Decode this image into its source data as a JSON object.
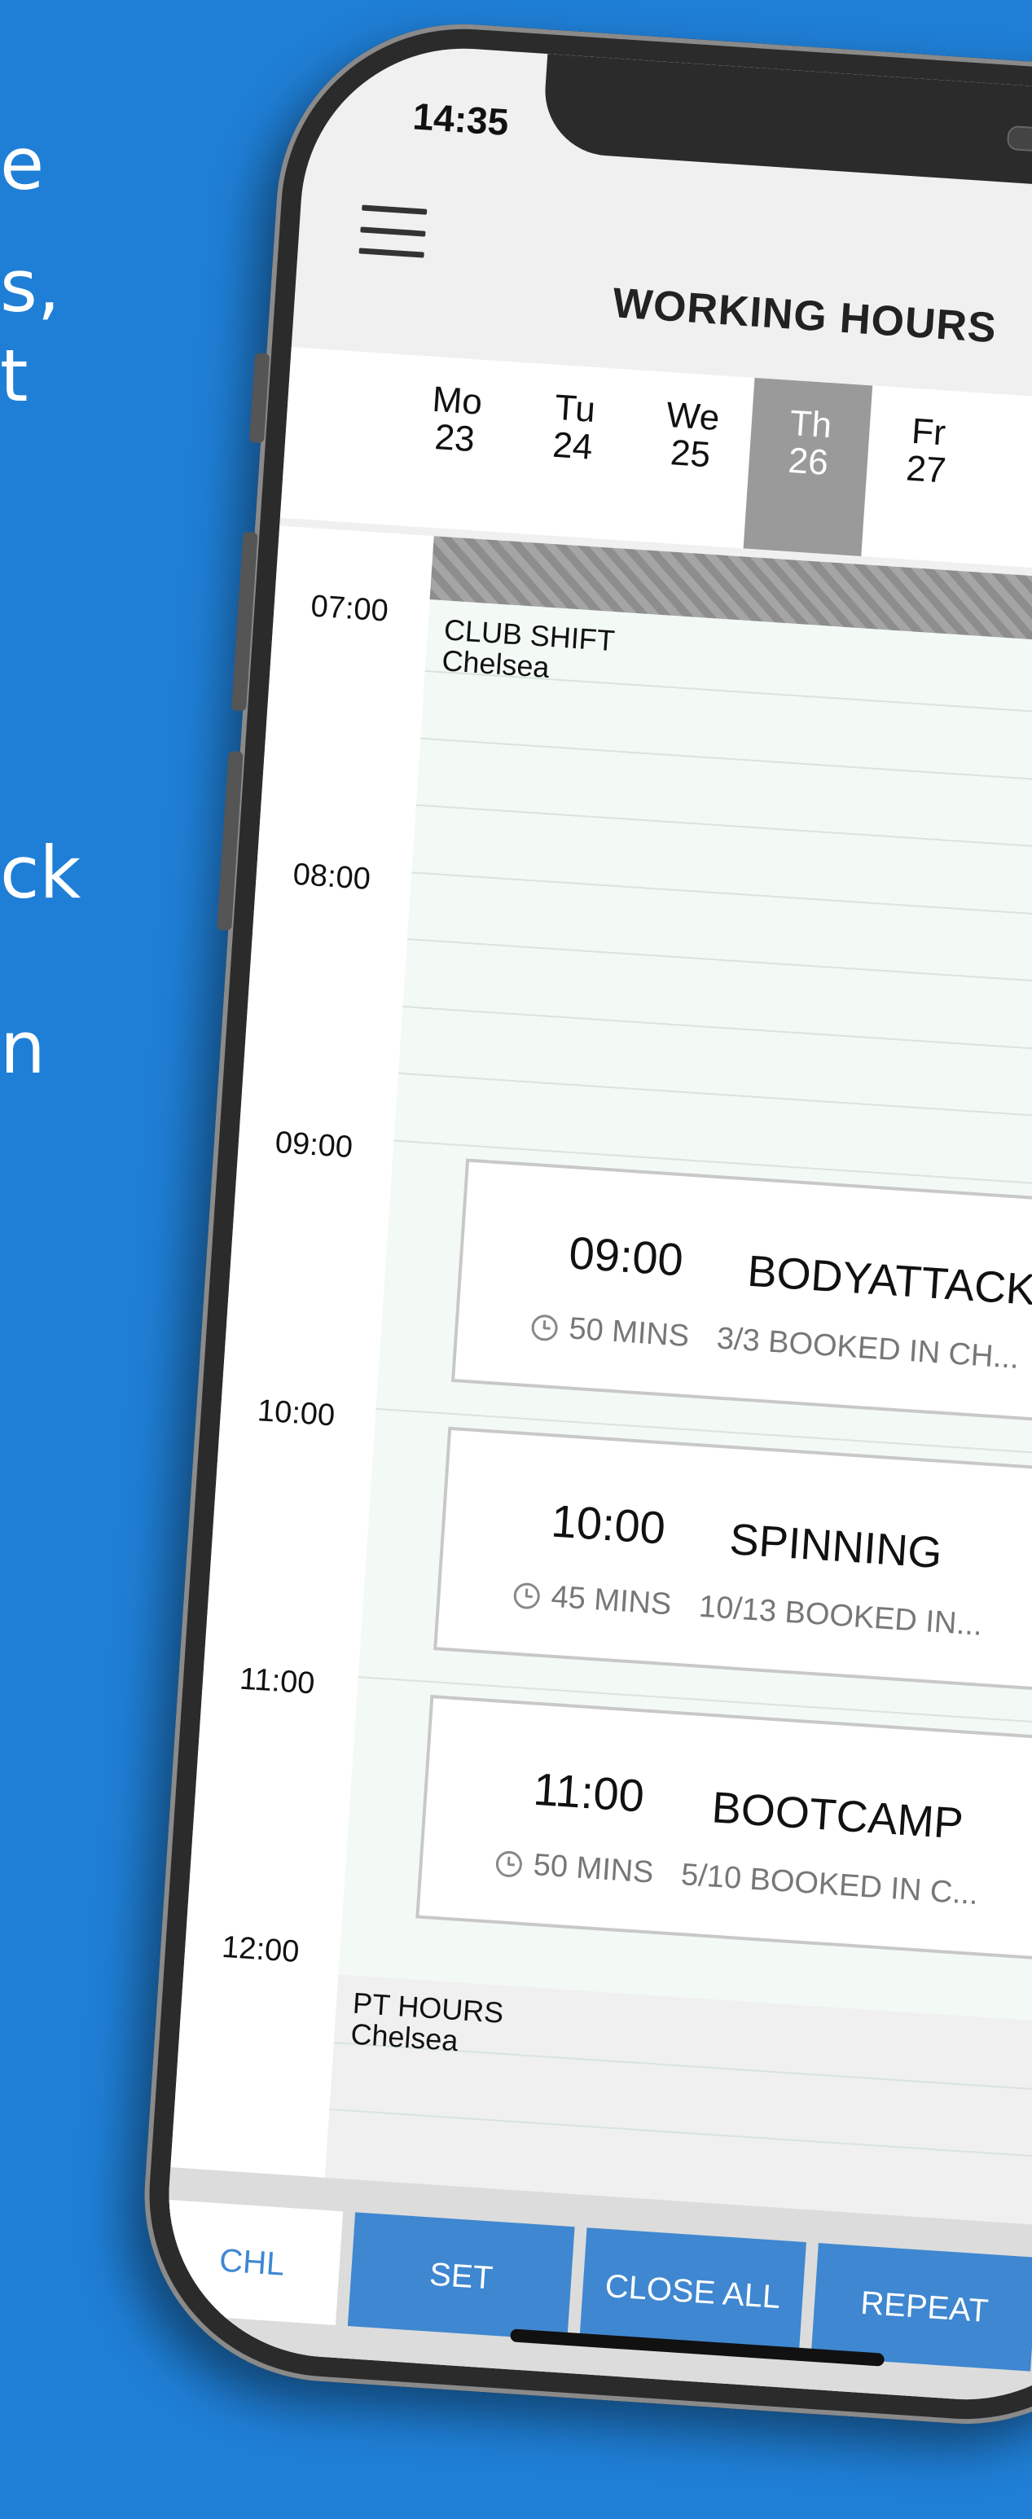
{
  "background_text": {
    "line1": "e",
    "line2": "s,",
    "line3": "t",
    "line4": "ck",
    "line5": "n"
  },
  "status_bar": {
    "time": "14:35"
  },
  "header": {
    "title": "WORKING HOURS"
  },
  "days": [
    {
      "name": "Mo",
      "date": "23"
    },
    {
      "name": "Tu",
      "date": "24"
    },
    {
      "name": "We",
      "date": "25"
    },
    {
      "name": "Th",
      "date": "26"
    },
    {
      "name": "Fr",
      "date": "27"
    }
  ],
  "selected_day_index": 3,
  "times": [
    "07:00",
    "08:00",
    "09:00",
    "10:00",
    "11:00",
    "12:00"
  ],
  "shifts": [
    {
      "title": "CLUB SHIFT",
      "location": "Chelsea"
    },
    {
      "title": "PT HOURS",
      "location": "Chelsea"
    }
  ],
  "classes": [
    {
      "time": "09:00",
      "name": "BODYATTACK",
      "duration": "50 MINS",
      "booking": "3/3 BOOKED IN CH..."
    },
    {
      "time": "10:00",
      "name": "SPINNING",
      "duration": "45 MINS",
      "booking": "10/13 BOOKED IN..."
    },
    {
      "time": "11:00",
      "name": "BOOTCAMP",
      "duration": "50 MINS",
      "booking": "5/10 BOOKED IN C..."
    }
  ],
  "bottom_bar": {
    "club": "CHL",
    "set": "SET",
    "close_all": "CLOSE ALL",
    "repeat": "REPEAT"
  },
  "colors": {
    "background": "#1f7fd6",
    "accent": "#3f87d0",
    "selected_day": "#9a9a9a"
  },
  "icons": {
    "menu": "hamburger-menu-icon",
    "duration": "clock-icon",
    "open": "chevron-right-icon"
  }
}
